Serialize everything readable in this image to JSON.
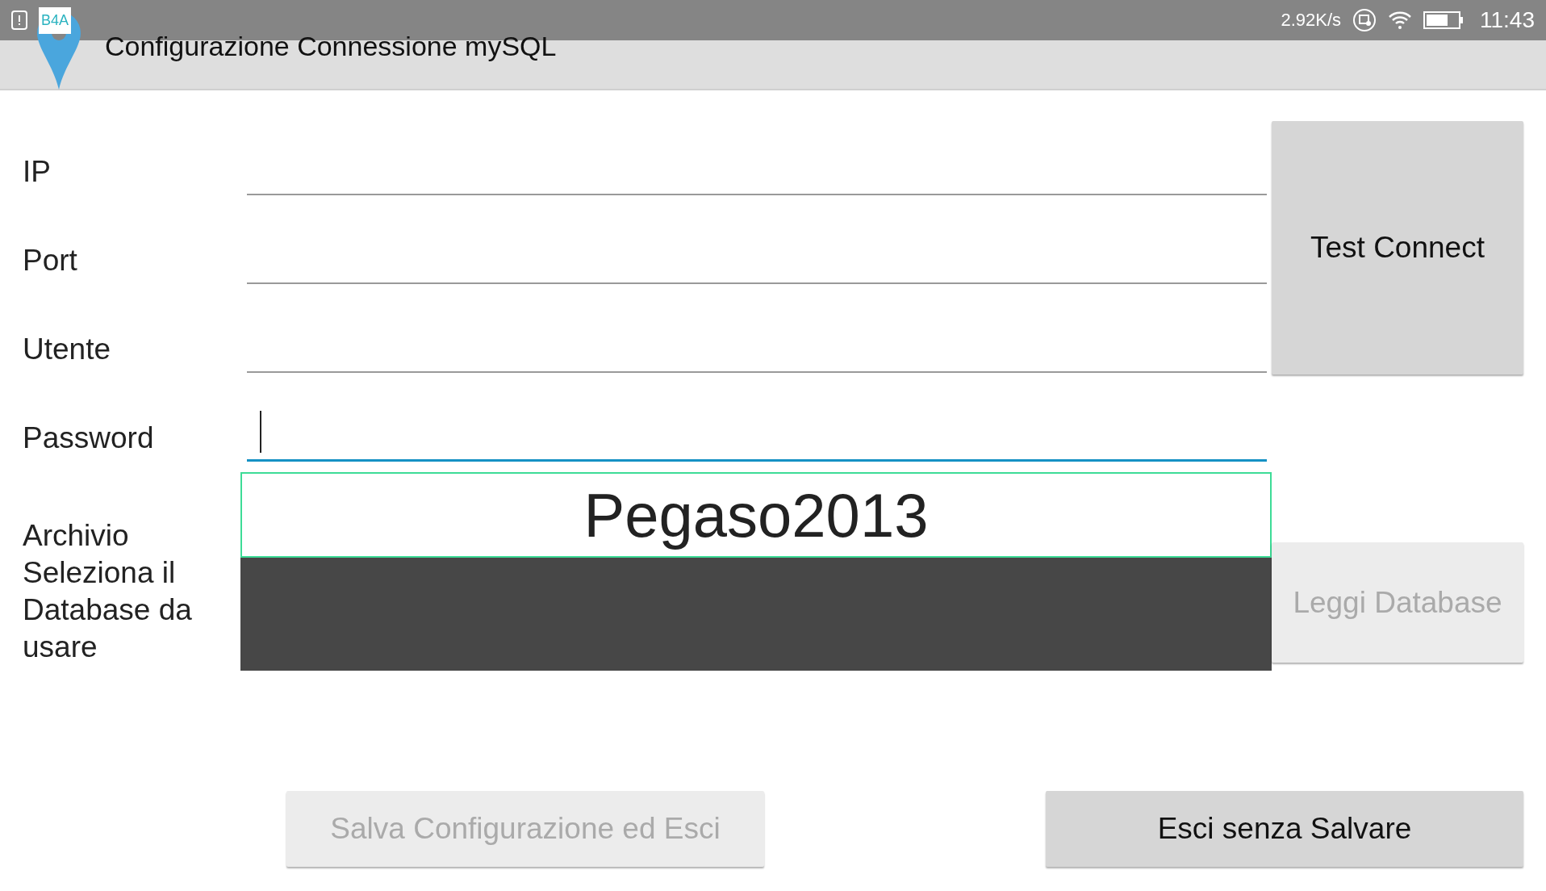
{
  "status_bar": {
    "notification_badge": "B4A",
    "network_speed": "2.92K/s",
    "time": "11:43"
  },
  "title_bar": {
    "title": "Configurazione Connessione mySQL"
  },
  "fields": [
    {
      "label": "IP",
      "focused": false
    },
    {
      "label": "Port",
      "focused": false
    },
    {
      "label": "Utente",
      "focused": false
    },
    {
      "label": "Password",
      "focused": true
    }
  ],
  "test_button": {
    "label": "Test Connect",
    "disabled": false
  },
  "database": {
    "label_lines": [
      "Archivio",
      "Seleziona il Database da usare"
    ],
    "selected_value": "Pegaso2013"
  },
  "read_button": {
    "label": "Leggi Database",
    "disabled": true
  },
  "bottom_buttons": [
    {
      "label": "Salva Configurazione ed Esci",
      "disabled": true
    },
    {
      "label": "Esci senza Salvare",
      "disabled": false
    }
  ]
}
